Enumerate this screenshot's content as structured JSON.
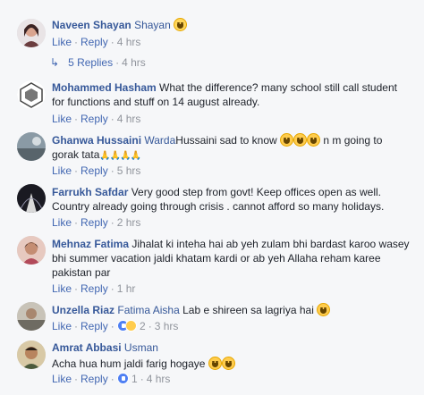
{
  "comments": [
    {
      "author": "Naveen Shayan",
      "tag": "Shayan",
      "text": "",
      "like": "Like",
      "reply": "Reply",
      "time": "4 hrs",
      "emoji": "crying-laughing-icon"
    },
    {
      "author": "Mohammed Hasham",
      "tag": "",
      "text": "What the difference? many school still call student for functions and stuff on 14 august already.",
      "like": "Like",
      "reply": "Reply",
      "time": "4 hrs"
    },
    {
      "author": "Ghanwa Hussaini",
      "tag": "Warda",
      "text": "Hussaini sad to know",
      "text2": "n m going to gorak tata",
      "like": "Like",
      "reply": "Reply",
      "time": "5 hrs",
      "hands": "🙏🙏🙏🙏"
    },
    {
      "author": "Farrukh Safdar",
      "tag": "",
      "text": "Very good step from govt! Keep offices open as well. Country already going through crisis . cannot afford so many holidays.",
      "like": "Like",
      "reply": "Reply",
      "time": "2 hrs"
    },
    {
      "author": "Mehnaz Fatima",
      "tag": "",
      "text": "Jihalat ki inteha hai ab yeh zulam bhi bardast karoo wasey bhi summer vacation jaldi khatam kardi or ab yeh Allaha reham karee pakistan par",
      "like": "Like",
      "reply": "Reply",
      "time": "1 hr"
    },
    {
      "author": "Unzella Riaz",
      "tag": "Fatima Aisha",
      "text": "Lab e shireen sa lagriya hai",
      "like": "Like",
      "reply": "Reply",
      "reactions": "2",
      "time": "3 hrs"
    },
    {
      "author": "Amrat Abbasi",
      "tag": "Usman",
      "text": "Acha hua hum jaldi farig hogaye",
      "like": "Like",
      "reply": "Reply",
      "reactions": "1",
      "time": "4 hrs"
    }
  ],
  "replies_thread": {
    "label": "5 Replies",
    "time": "4 hrs"
  },
  "colors": {
    "author": "#365899",
    "link": "#4267b2",
    "meta": "#90949c",
    "background": "#f6f7f9"
  }
}
